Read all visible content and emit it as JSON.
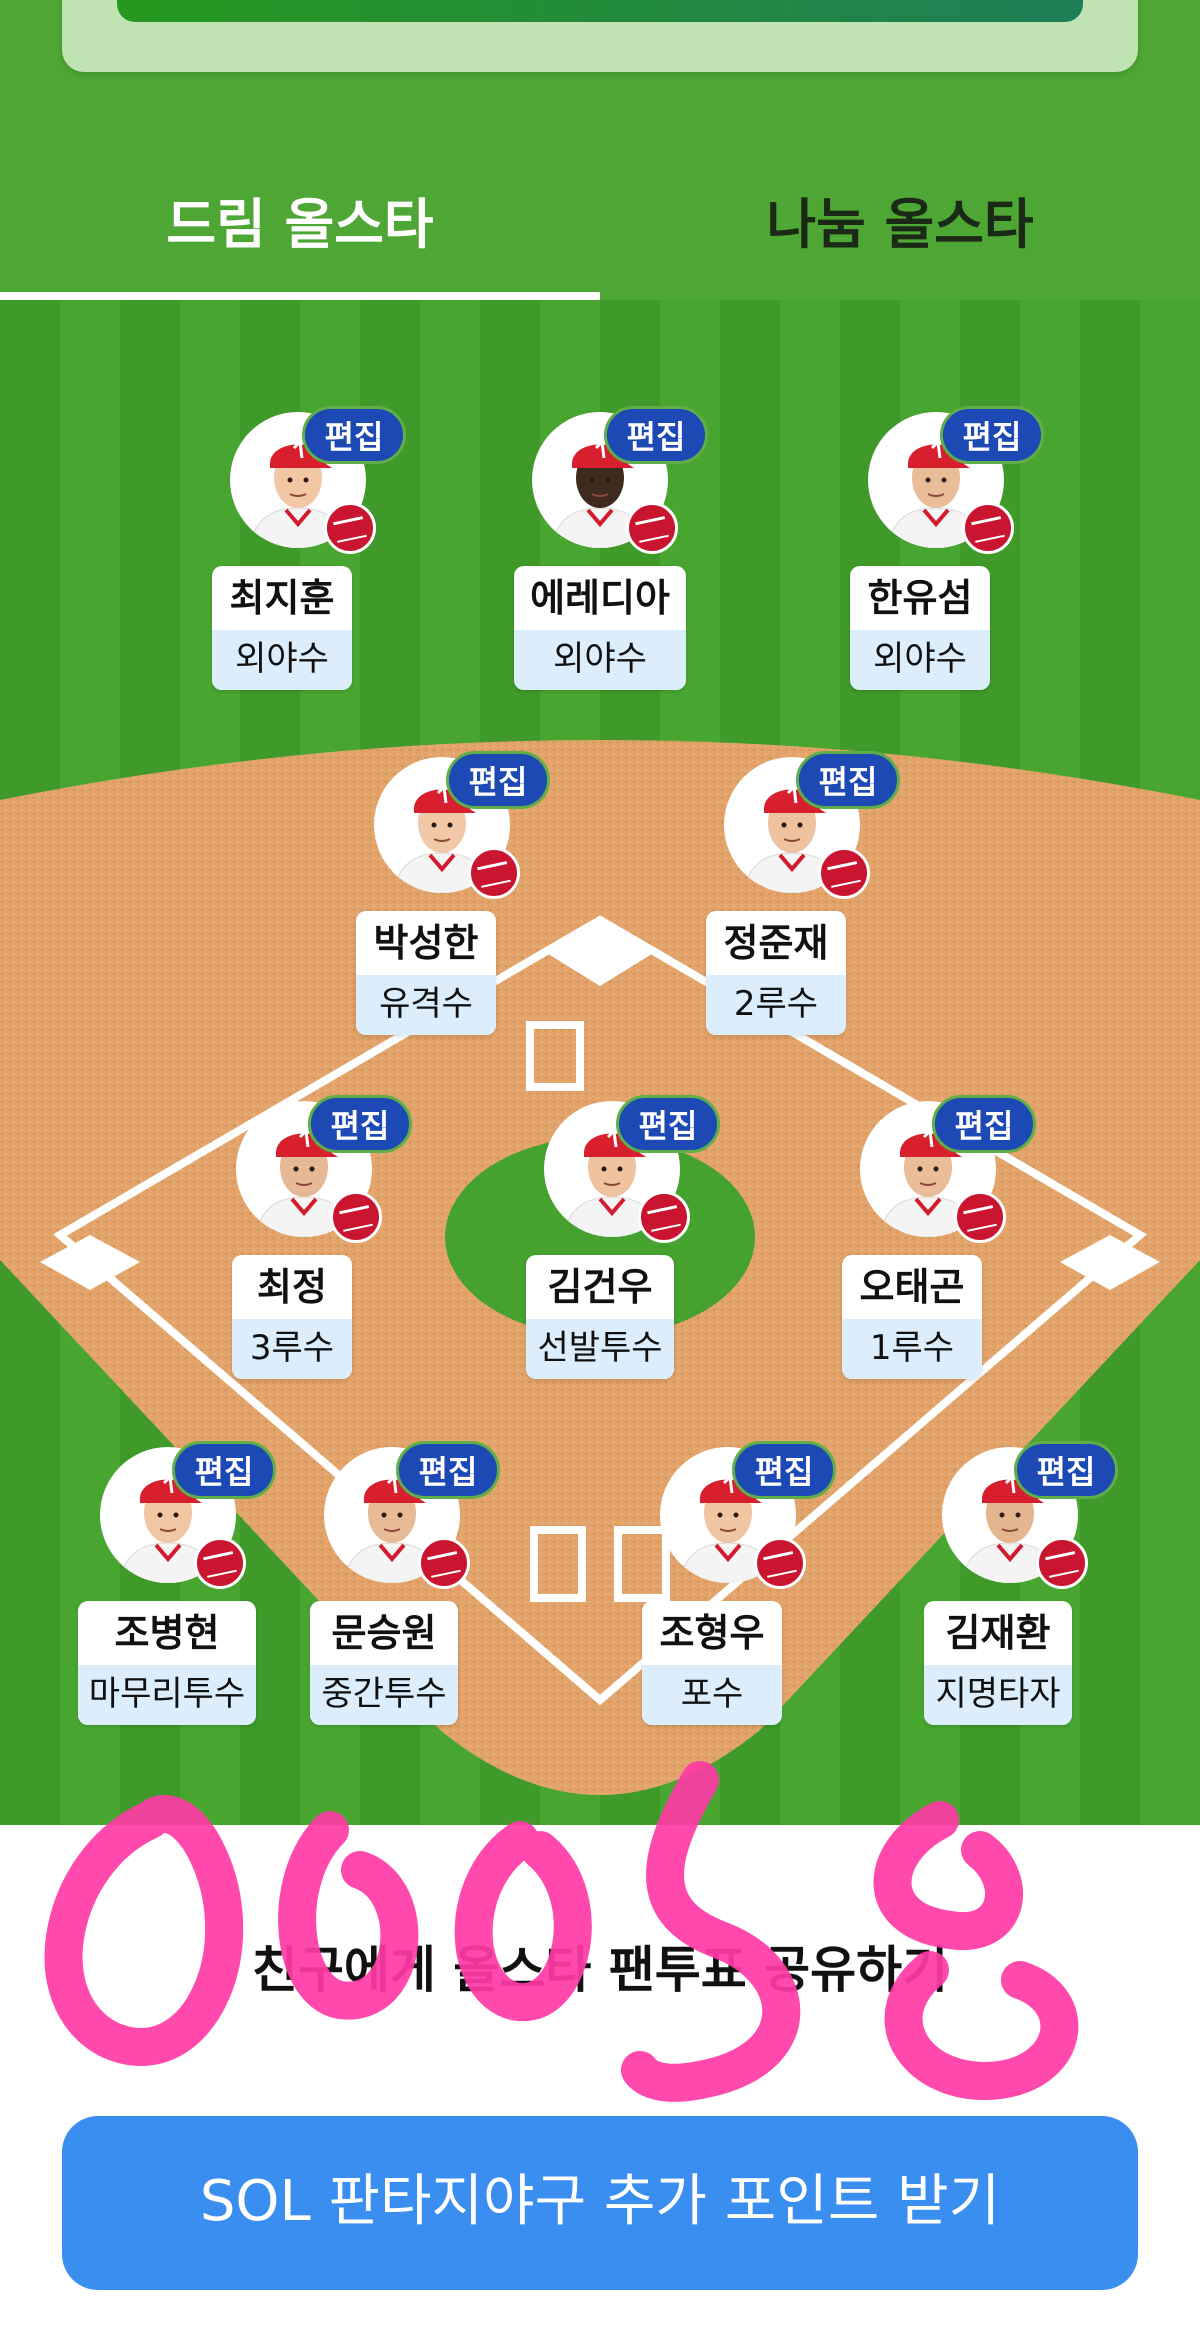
{
  "tabs": {
    "dream": "드림 올스타",
    "nanum": "나눔 올스타"
  },
  "edit_label": "편집",
  "players": [
    {
      "name": "최지훈",
      "position": "외야수",
      "skin": "#f1c7a6"
    },
    {
      "name": "에레디아",
      "position": "외야수",
      "skin": "#3f2a1e"
    },
    {
      "name": "한유섬",
      "position": "외야수",
      "skin": "#e9bd98"
    },
    {
      "name": "박성한",
      "position": "유격수",
      "skin": "#f1c8a8"
    },
    {
      "name": "정준재",
      "position": "2루수",
      "skin": "#efc29f"
    },
    {
      "name": "최정",
      "position": "3루수",
      "skin": "#e6b996"
    },
    {
      "name": "김건우",
      "position": "선발투수",
      "skin": "#efc3a0"
    },
    {
      "name": "오태곤",
      "position": "1루수",
      "skin": "#e9bd98"
    },
    {
      "name": "조병현",
      "position": "마무리투수",
      "skin": "#f0c6a4"
    },
    {
      "name": "문승원",
      "position": "중간투수",
      "skin": "#e8bb96"
    },
    {
      "name": "조형우",
      "position": "포수",
      "skin": "#f0c5a3"
    },
    {
      "name": "김재환",
      "position": "지명타자",
      "skin": "#e4b690"
    }
  ],
  "share": {
    "label": "친구에게 올스타 팬투표 공유하기"
  },
  "points_button": {
    "label": "SOL 판타지야구 추가 포인트 받기"
  },
  "colors": {
    "grass": "#45a22e",
    "dirt": "#e3a56b",
    "edit_badge": "#1d49b4",
    "button": "#3a8ef0",
    "doodle": "#ff4aa8"
  }
}
